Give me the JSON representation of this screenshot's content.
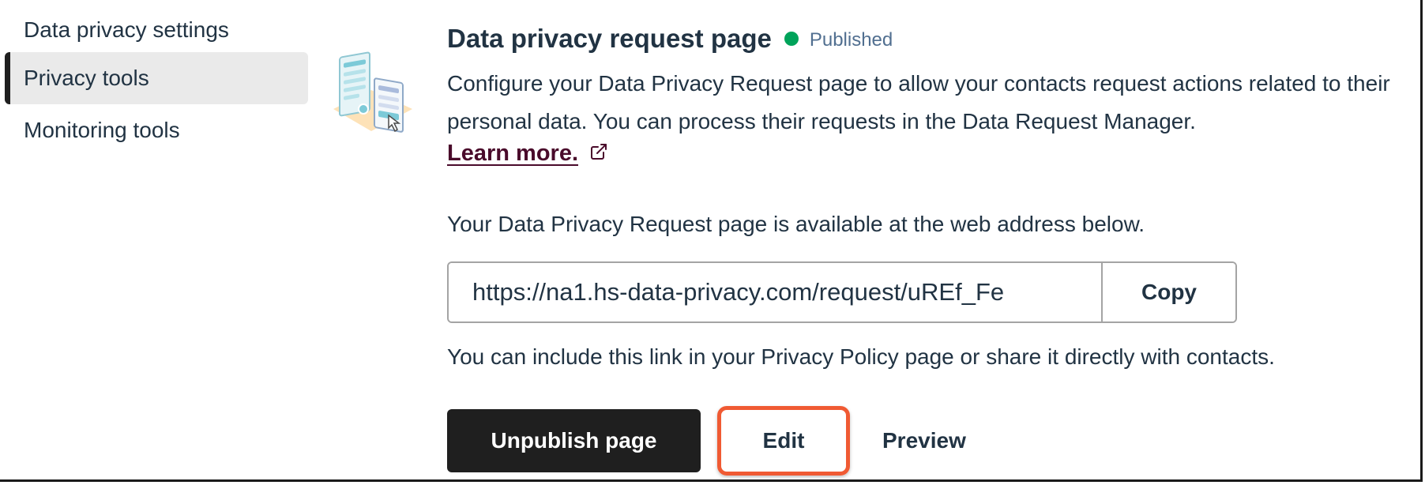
{
  "sidebar": {
    "items": [
      {
        "label": "Data privacy settings",
        "active": false
      },
      {
        "label": "Privacy tools",
        "active": true
      },
      {
        "label": "Monitoring tools",
        "active": false
      }
    ]
  },
  "main": {
    "title": "Data privacy request page",
    "status": "Published",
    "status_color": "#00a35a",
    "description": "Configure your Data Privacy Request page to allow your contacts request actions related to their personal data. You can process their requests in the Data Request Manager.",
    "learn_more": "Learn more.",
    "learn_more_icon": "external-link-icon",
    "available_text": "Your Data Privacy Request page is available at the web address below.",
    "url_value": "https://na1.hs-data-privacy.com/request/uREf_Fe",
    "copy_label": "Copy",
    "share_text": "You can include this link in your Privacy Policy page or share it directly with contacts.",
    "actions": {
      "unpublish_label": "Unpublish page",
      "edit_label": "Edit",
      "preview_label": "Preview"
    },
    "highlight_color": "#f05a33"
  }
}
